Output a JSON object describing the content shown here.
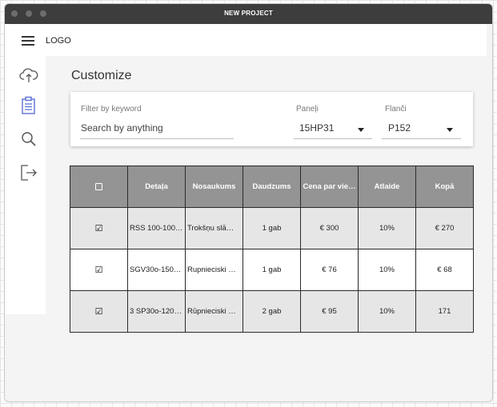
{
  "window": {
    "title": "NEW PROJECT"
  },
  "header": {
    "logo": "LOGO",
    "menu_icon": "hamburger-menu-icon"
  },
  "sidebar": {
    "items": [
      {
        "icon": "cloud-upload-icon"
      },
      {
        "icon": "clipboard-icon"
      },
      {
        "icon": "search-icon"
      },
      {
        "icon": "logout-icon"
      }
    ]
  },
  "main": {
    "title": "Customize",
    "filter": {
      "keyword_label": "Filter by keyword",
      "keyword_placeholder": "Search by anything",
      "paneli_label": "Paneļi",
      "paneli_value": "15HP31",
      "flanci_label": "Flanči",
      "flanci_value": "P152"
    },
    "table": {
      "headers": [
        "",
        "Detaļa",
        "Nosaukums",
        "Daudzums",
        "Cena par vie…",
        "Atlaide",
        "Kopā"
      ],
      "rows": [
        {
          "checked": "☑",
          "detala": "RSS 100-100…",
          "nosaukums": "Trokšņu slā…",
          "daudzums": "1 gab",
          "cena": "€ 300",
          "atlaide": "10%",
          "kopa": "€ 270"
        },
        {
          "checked": "☑",
          "detala": "SGV30o-150…",
          "nosaukums": "Rupnieciski …",
          "daudzums": "1 gab",
          "cena": "€ 76",
          "atlaide": "10%",
          "kopa": "€ 68"
        },
        {
          "checked": "☑",
          "detala": "3 SP30o-120…",
          "nosaukums": "Rūpnieciski …",
          "daudzums": "2 gab",
          "cena": "€ 95",
          "atlaide": "10%",
          "kopa": "171"
        }
      ]
    }
  },
  "colors": {
    "titlebar": "#3d3d3d",
    "table_header": "#949494",
    "sidebar_accent": "#5b6fd6"
  }
}
